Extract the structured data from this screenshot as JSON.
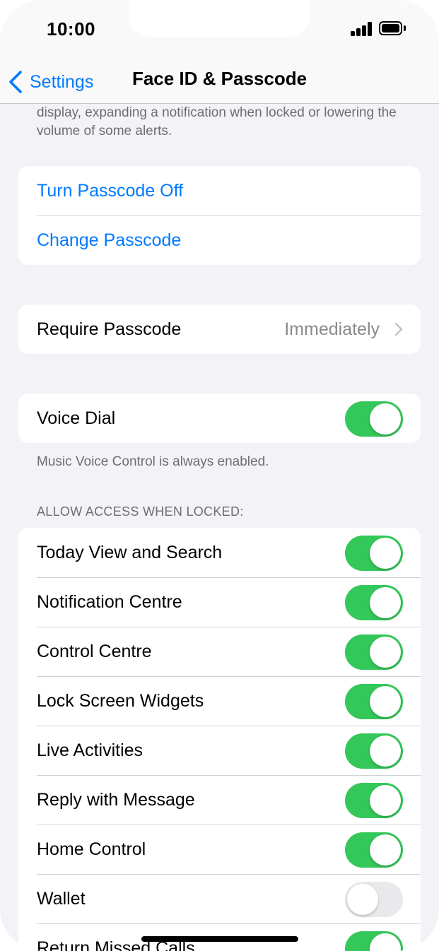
{
  "status": {
    "time": "10:00"
  },
  "nav": {
    "back_label": "Settings",
    "title": "Face ID & Passcode"
  },
  "top_note": "display, expanding a notification when locked or lowering the volume of some alerts.",
  "passcode_group": {
    "turn_off": "Turn Passcode Off",
    "change": "Change Passcode"
  },
  "require": {
    "label": "Require Passcode",
    "value": "Immediately"
  },
  "voice_dial": {
    "label": "Voice Dial",
    "on": true,
    "footer": "Music Voice Control is always enabled."
  },
  "access": {
    "header": "ALLOW ACCESS WHEN LOCKED:",
    "items": [
      {
        "label": "Today View and Search",
        "on": true
      },
      {
        "label": "Notification Centre",
        "on": true
      },
      {
        "label": "Control Centre",
        "on": true
      },
      {
        "label": "Lock Screen Widgets",
        "on": true
      },
      {
        "label": "Live Activities",
        "on": true
      },
      {
        "label": "Reply with Message",
        "on": true
      },
      {
        "label": "Home Control",
        "on": true
      },
      {
        "label": "Wallet",
        "on": false
      },
      {
        "label": "Return Missed Calls",
        "on": true
      }
    ]
  },
  "colors": {
    "accent": "#007aff",
    "toggle_on": "#34c759",
    "toggle_off": "#e9e9eb",
    "background": "#f2f2f7"
  }
}
